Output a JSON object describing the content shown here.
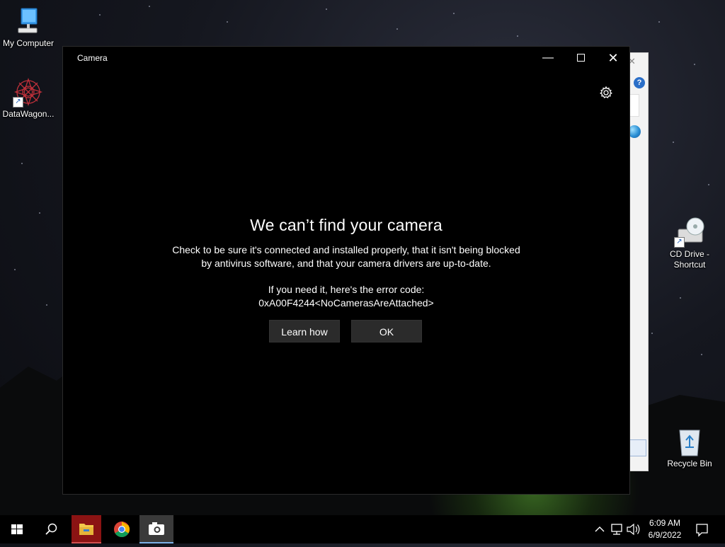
{
  "desktop": {
    "icons": [
      {
        "label": "My Computer",
        "icon": "computer-icon"
      },
      {
        "label": "DataWagon...",
        "icon": "datawagon-icon"
      },
      {
        "label": "CD Drive - Shortcut",
        "icon": "cd-drive-icon"
      },
      {
        "label": "Recycle Bin",
        "icon": "recycle-bin-icon"
      }
    ]
  },
  "camera_window": {
    "title": "Camera",
    "controls": {
      "minimize": "minimize-icon",
      "maximize": "maximize-icon",
      "close": "close-icon"
    },
    "settings_icon": "gear-icon",
    "heading": "We can’t find your camera",
    "body_line1": "Check to be sure it's connected and installed properly, that it isn't being blocked",
    "body_line2": "by antivirus software, and that your camera drivers are up-to-date.",
    "error_label": "If you need it, here's the error code:",
    "error_code": "0xA00F4244<NoCamerasAreAttached>",
    "buttons": {
      "learn_how": "Learn how",
      "ok": "OK"
    }
  },
  "taskbar": {
    "items": [
      "start-icon",
      "search-icon",
      "file-explorer-icon",
      "chrome-icon",
      "camera-icon"
    ],
    "tray": {
      "icons": [
        "chevron-up-icon",
        "network-icon",
        "volume-icon",
        "notification-icon"
      ],
      "time": "6:09 AM",
      "date": "6/9/2022"
    }
  },
  "colors": {
    "window_bg": "#000000",
    "button_bg": "#2b2b2b",
    "explorer_active": "#8b1313",
    "camera_active": "#3a3a3a"
  }
}
